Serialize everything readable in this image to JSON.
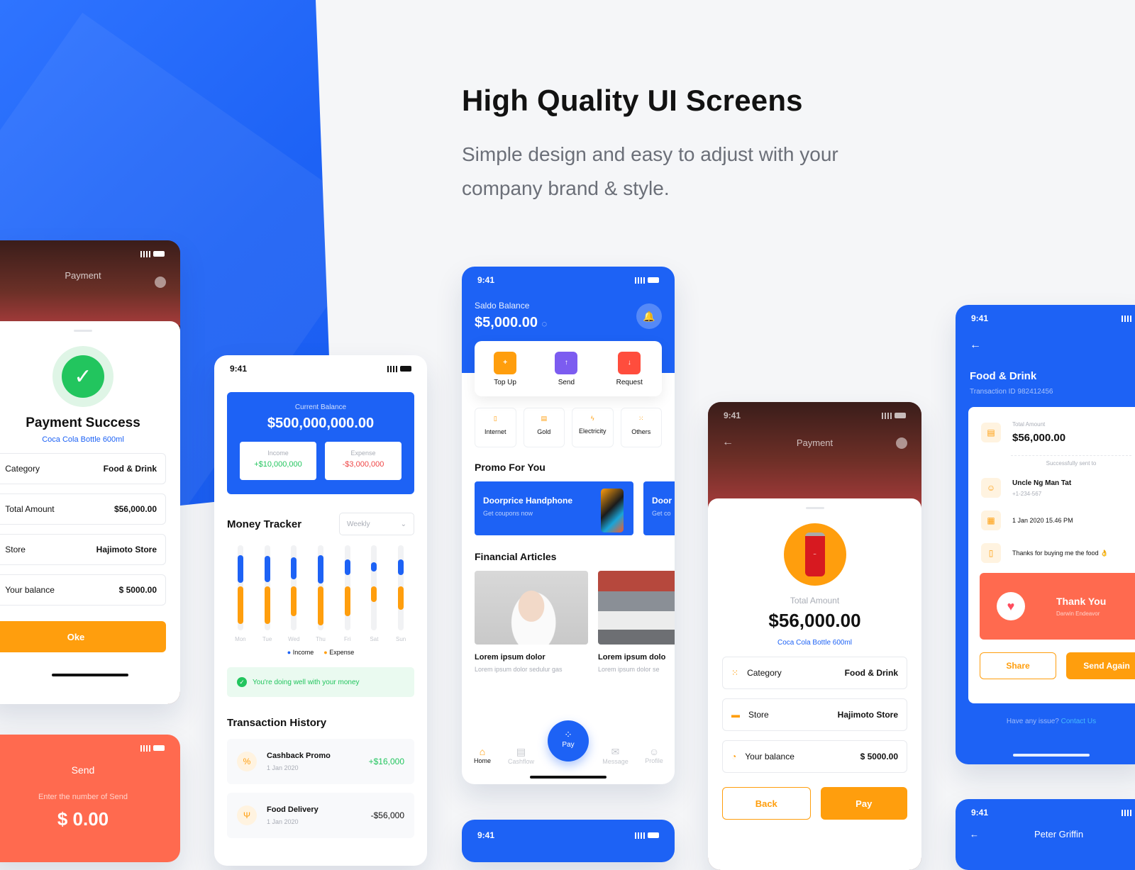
{
  "hero": {
    "title": "High Quality UI Screens",
    "subtitle": "Simple design and easy to adjust with your company brand & style."
  },
  "status": {
    "time": "9:41"
  },
  "success": {
    "header": "Payment",
    "title": "Payment Success",
    "subtitle": "Coca Cola Bottle 600ml",
    "rows": [
      {
        "label": "Category",
        "value": "Food & Drink"
      },
      {
        "label": "Total Amount",
        "value": "$56,000.00"
      },
      {
        "label": "Store",
        "value": "Hajimoto Store"
      },
      {
        "label": "Your balance",
        "value": "$ 5000.00"
      }
    ],
    "button": "Oke"
  },
  "send": {
    "title": "Send",
    "hint": "Enter the number of Send",
    "amount": "$ 0.00"
  },
  "tracker": {
    "balance_label": "Current Balance",
    "balance": "$500,000,000.00",
    "income_label": "Income",
    "income": "+$10,000,000",
    "expense_label": "Expense",
    "expense": "-$3,000,000",
    "title": "Money Tracker",
    "period": "Weekly",
    "days": [
      "Mon",
      "Tue",
      "Wed",
      "Thu",
      "Fri",
      "Sat",
      "Sun"
    ],
    "legend_income": "Income",
    "legend_expense": "Expense",
    "banner": "You're doing well with your money",
    "history_title": "Transaction History",
    "history": [
      {
        "name": "Cashback Promo",
        "date": "1 Jan 2020",
        "amount": "+$16,000"
      },
      {
        "name": "Food Delivery",
        "date": "1 Jan 2020",
        "amount": "-$56,000"
      }
    ]
  },
  "home": {
    "balance_label": "Saldo Balance",
    "balance": "$5,000.00",
    "actions": [
      "Top Up",
      "Send",
      "Request"
    ],
    "services": [
      "Internet",
      "Gold",
      "Electricity",
      "Others"
    ],
    "promo_title": "Promo For You",
    "promos": [
      {
        "title": "Doorprice Handphone",
        "sub": "Get coupons now"
      },
      {
        "title": "Door",
        "sub": "Get co"
      }
    ],
    "articles_title": "Financial Articles",
    "articles": [
      {
        "title": "Lorem ipsum dolor",
        "sub": "Lorem ipsum dolor sedulur gas"
      },
      {
        "title": "Lorem ipsum dolo",
        "sub": "Lorem ipsum dolor se"
      }
    ],
    "nav": [
      "Home",
      "Cashflow",
      "Pay",
      "Message",
      "Profile"
    ]
  },
  "pay": {
    "header": "Payment",
    "total_label": "Total Amount",
    "total": "$56,000.00",
    "item": "Coca Cola Bottle 600ml",
    "rows": [
      {
        "label": "Category",
        "value": "Food & Drink"
      },
      {
        "label": "Store",
        "value": "Hajimoto Store"
      },
      {
        "label": "Your balance",
        "value": "$ 5000.00"
      }
    ],
    "back": "Back",
    "pay": "Pay"
  },
  "receipt": {
    "title": "Food & Drink",
    "txid": "Transaction ID 982412456",
    "amount_label": "Total Amount",
    "amount": "$56,000.00",
    "sent_to": "Successfully sent to",
    "recipient": "Uncle Ng Man Tat",
    "phone": "+1-234-567",
    "date": "1 Jan 2020 15.46 PM",
    "note": "Thanks for buying me the food 👌",
    "thanks": "Thank You",
    "thanks_sub": "Darwin Endeavor",
    "share": "Share",
    "send_again": "Send Again",
    "issue": "Have any issue?",
    "contact": "Contact Us"
  },
  "peter": {
    "name": "Peter Griffin"
  }
}
